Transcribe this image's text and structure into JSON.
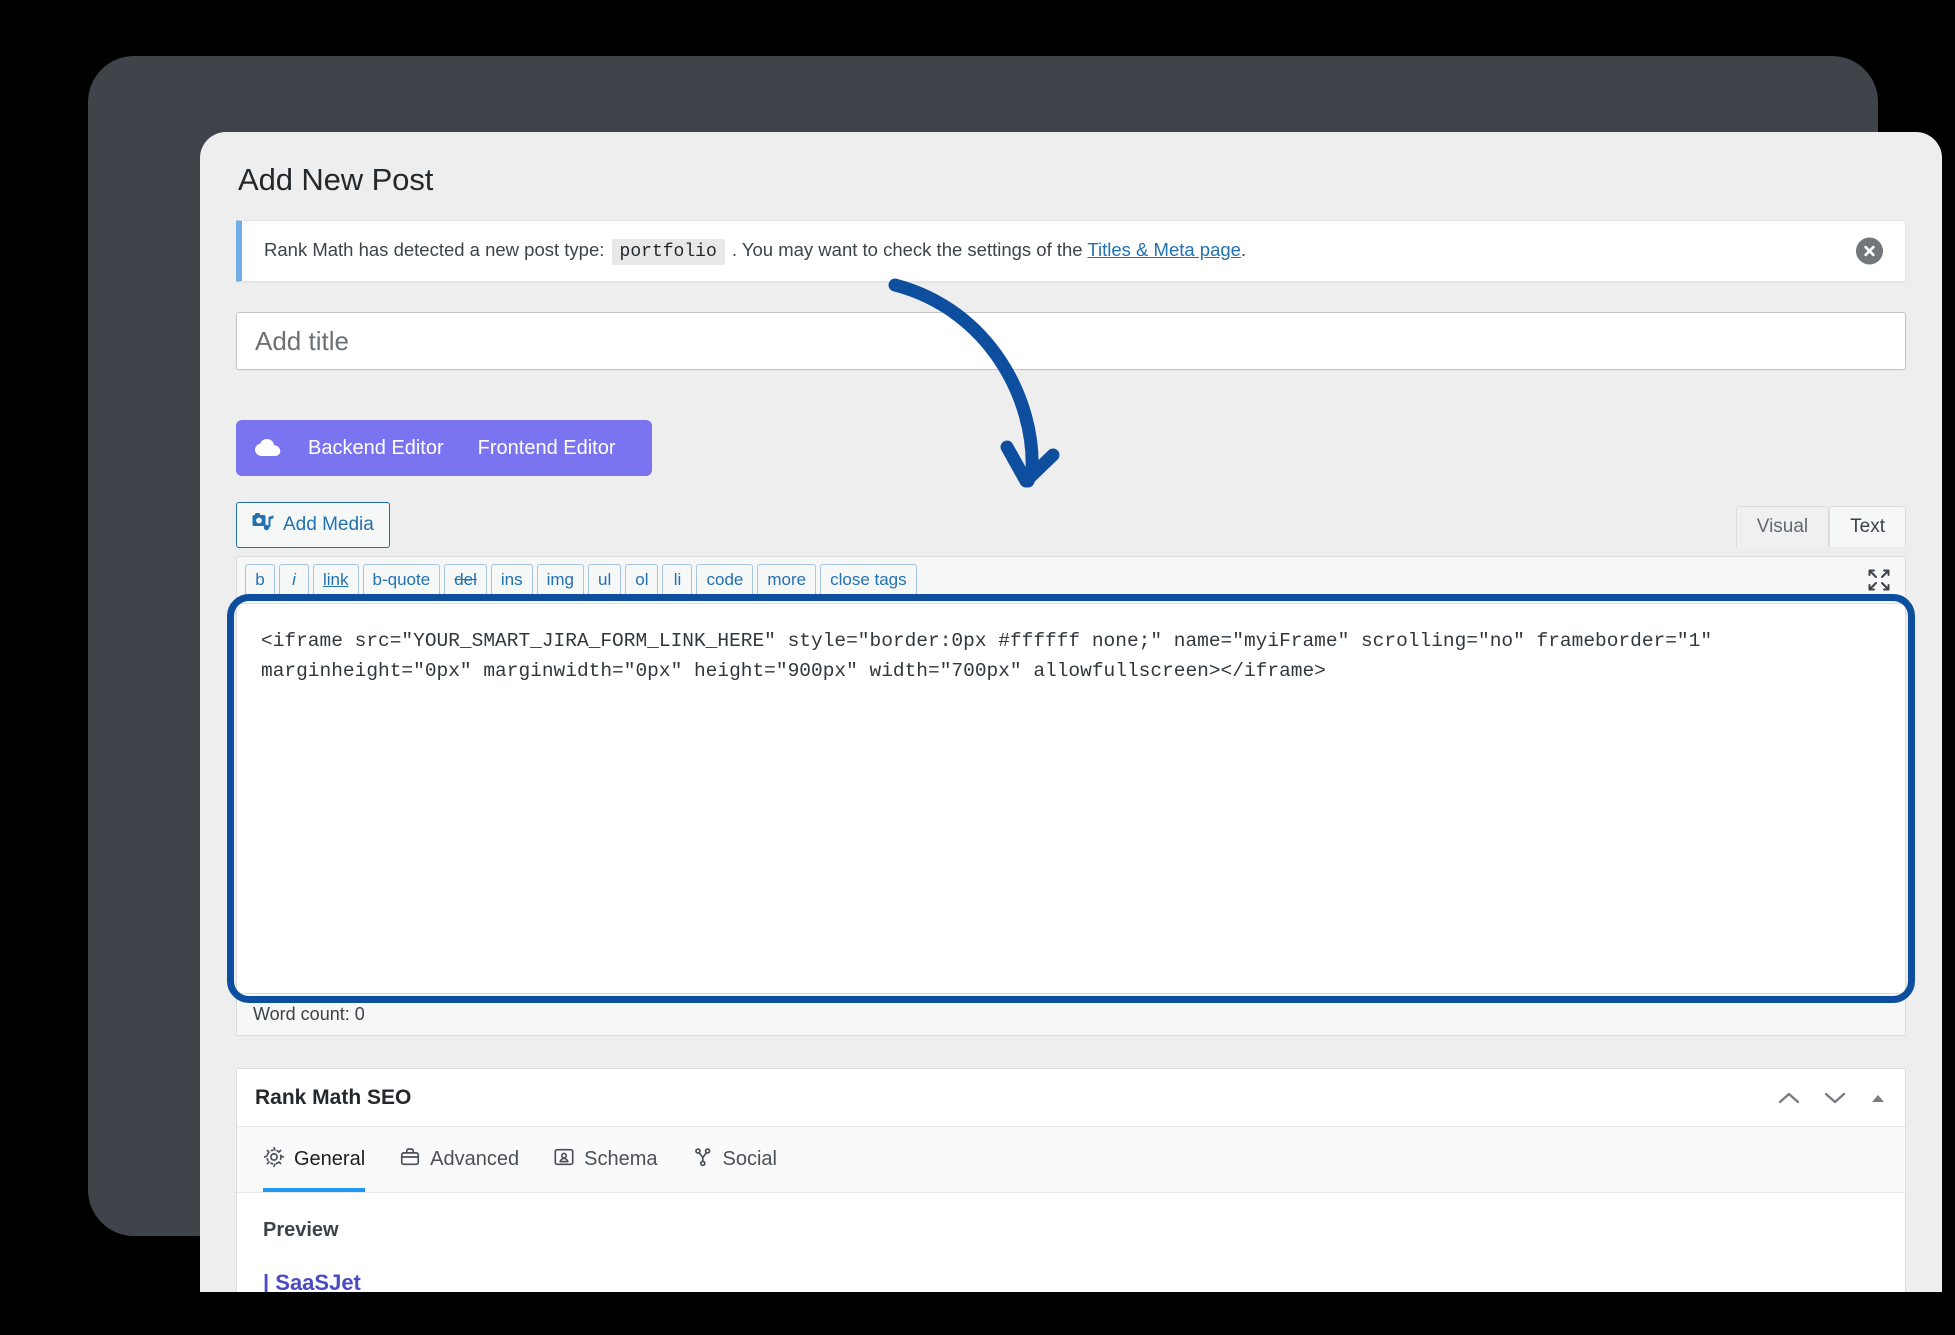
{
  "colors": {
    "device_frame": "#3f444b",
    "page_bg": "#eeeeee",
    "wpbakery_purple": "#7b74f0",
    "link_blue": "#2271b1",
    "annotation_blue": "#0d4f9e",
    "active_tab_underline": "#2196f3",
    "notice_accent": "#72aee6"
  },
  "page": {
    "title": "Add New Post"
  },
  "notice": {
    "text_before": "Rank Math has detected a new post type:",
    "post_type": "portfolio",
    "text_middle": ". You may want to check the settings of the",
    "link_label": "Titles & Meta page",
    "text_after": ".",
    "dismiss_icon": "close-circle-icon"
  },
  "title_field": {
    "placeholder": "Add title",
    "value": ""
  },
  "wpbakery": {
    "cloud_icon": "cloud-icon",
    "backend_label": "Backend Editor",
    "frontend_label": "Frontend Editor"
  },
  "editor": {
    "add_media_label": "Add Media",
    "add_media_icon": "media-icon",
    "fullscreen_icon": "fullscreen-icon",
    "tabs": [
      {
        "label": "Visual",
        "active": false
      },
      {
        "label": "Text",
        "active": true
      }
    ],
    "quicktags": [
      {
        "label": "b",
        "style": "bold"
      },
      {
        "label": "i",
        "style": "italic"
      },
      {
        "label": "link",
        "style": "under"
      },
      {
        "label": "b-quote",
        "style": "normal"
      },
      {
        "label": "del",
        "style": "strike"
      },
      {
        "label": "ins",
        "style": "normal"
      },
      {
        "label": "img",
        "style": "normal"
      },
      {
        "label": "ul",
        "style": "normal"
      },
      {
        "label": "ol",
        "style": "normal"
      },
      {
        "label": "li",
        "style": "normal"
      },
      {
        "label": "code",
        "style": "normal"
      },
      {
        "label": "more",
        "style": "normal"
      },
      {
        "label": "close tags",
        "style": "normal"
      }
    ],
    "content": "<iframe src=\"YOUR_SMART_JIRA_FORM_LINK_HERE\" style=\"border:0px #ffffff none;\" name=\"myiFrame\" scrolling=\"no\" frameborder=\"1\" marginheight=\"0px\" marginwidth=\"0px\" height=\"900px\" width=\"700px\" allowfullscreen></iframe>",
    "word_count_label": "Word count: 0"
  },
  "rank_math": {
    "panel_title": "Rank Math SEO",
    "controls": [
      {
        "name": "move-up",
        "icon": "chevron-up-icon"
      },
      {
        "name": "move-down",
        "icon": "chevron-down-icon"
      },
      {
        "name": "toggle-panel",
        "icon": "triangle-up-icon"
      }
    ],
    "tabs": [
      {
        "label": "General",
        "icon": "gear-icon",
        "active": true
      },
      {
        "label": "Advanced",
        "icon": "briefcase-icon",
        "active": false
      },
      {
        "label": "Schema",
        "icon": "schema-icon",
        "active": false
      },
      {
        "label": "Social",
        "icon": "share-icon",
        "active": false
      }
    ],
    "preview_label": "Preview",
    "snippet_link": "| SaaSJet"
  },
  "annotation": {
    "arrow_icon": "curved-arrow-icon",
    "highlight_target": "code-textarea"
  }
}
